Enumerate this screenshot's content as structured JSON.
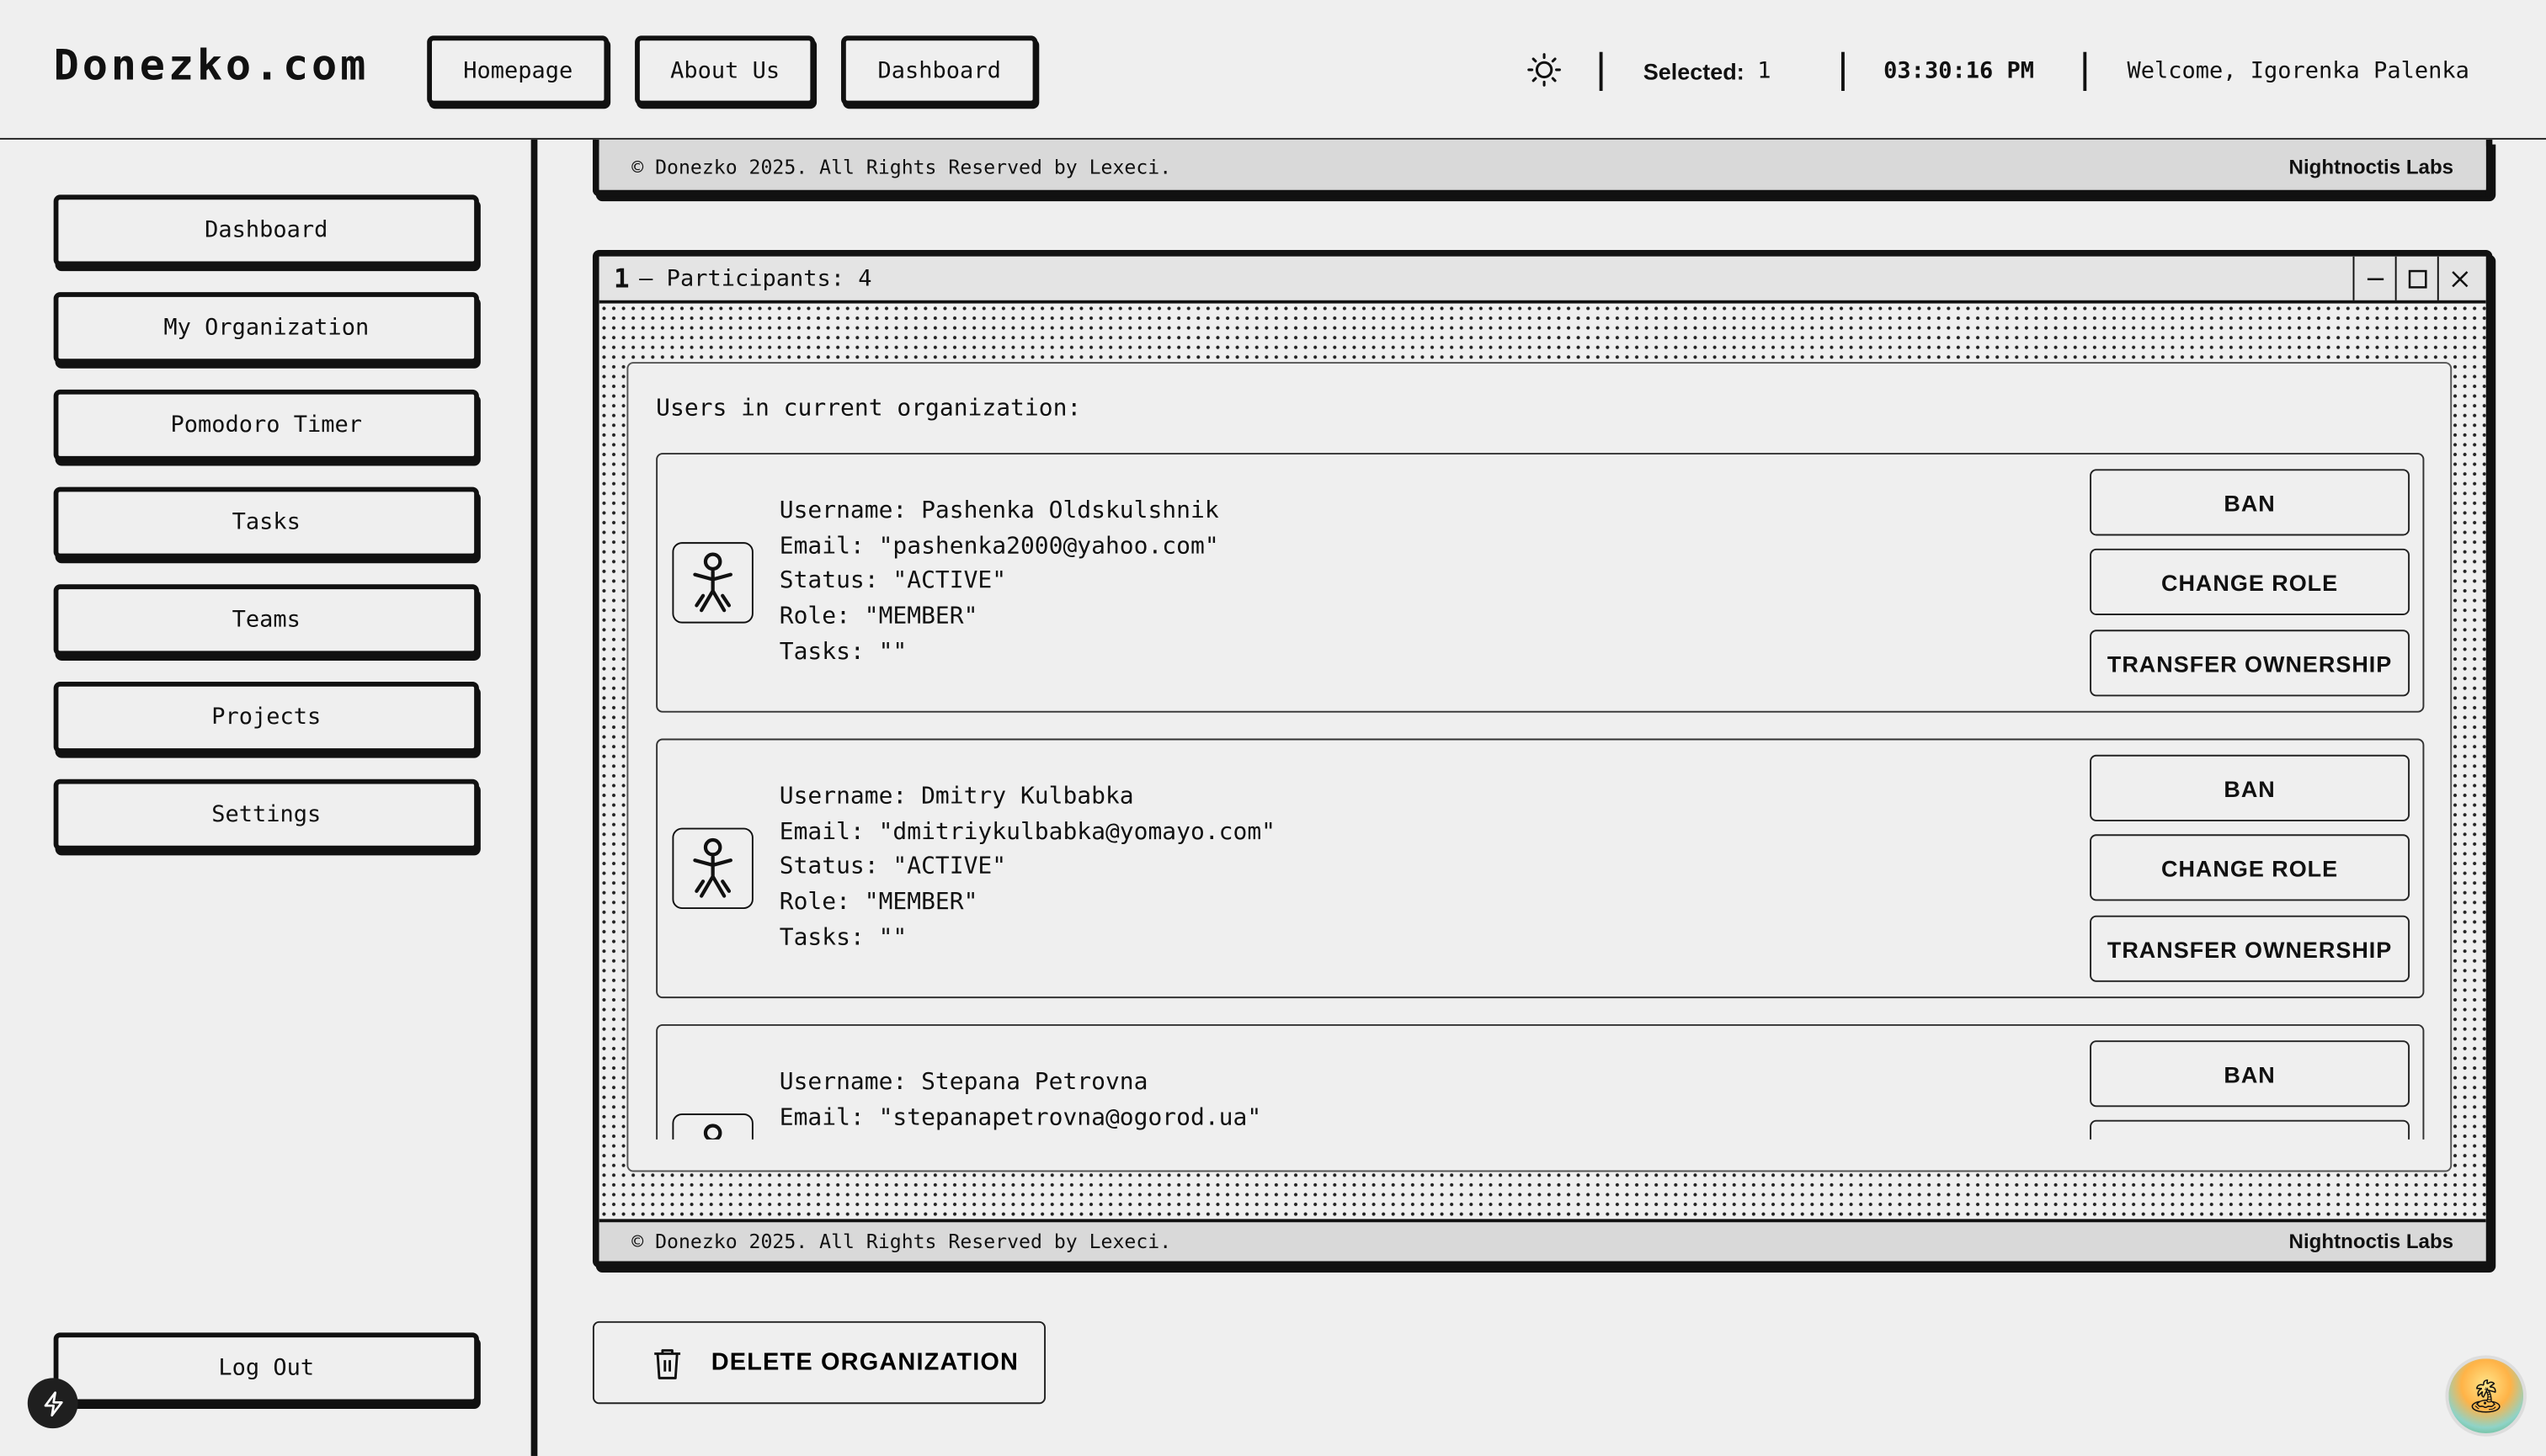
{
  "header": {
    "logo": "Donezko.com",
    "nav": [
      "Homepage",
      "About Us",
      "Dashboard"
    ],
    "selected_label": "Selected:",
    "selected_count": "1",
    "time": "03:30:16 PM",
    "welcome": "Welcome, Igorenka Palenka"
  },
  "sidebar": {
    "items": [
      "Dashboard",
      "My Organization",
      "Pomodoro Timer",
      "Tasks",
      "Teams",
      "Projects",
      "Settings"
    ],
    "logout": "Log Out"
  },
  "footer": {
    "copyright": "© Donezko 2025. All Rights Reserved by Lexeci.",
    "labs": "Nightnoctis Labs"
  },
  "window": {
    "number": "1",
    "title": "– Participants: 4",
    "heading": "Users in current organization:",
    "users": [
      {
        "username": "Username: Pashenka Oldskulshnik",
        "email": "Email: \"pashenka2000@yahoo.com\"",
        "status": "Status: \"ACTIVE\"",
        "role": "Role: \"MEMBER\"",
        "tasks": "Tasks: \"\""
      },
      {
        "username": "Username: Dmitry Kulbabka",
        "email": "Email: \"dmitriykulbabka@yomayo.com\"",
        "status": "Status: \"ACTIVE\"",
        "role": "Role: \"MEMBER\"",
        "tasks": "Tasks: \"\""
      },
      {
        "username": "Username: Stepana Petrovna",
        "email": "Email: \"stepanapetrovna@ogorod.ua\""
      }
    ],
    "actions": {
      "ban": "BAN",
      "change_role": "CHANGE ROLE",
      "transfer": "TRANSFER OWNERSHIP"
    }
  },
  "delete_org": "DELETE ORGANIZATION",
  "icons": [
    "sun-icon",
    "user-icon",
    "minimize-icon",
    "maximize-icon",
    "close-icon",
    "trash-icon",
    "bolt-icon",
    "beach-icon"
  ]
}
